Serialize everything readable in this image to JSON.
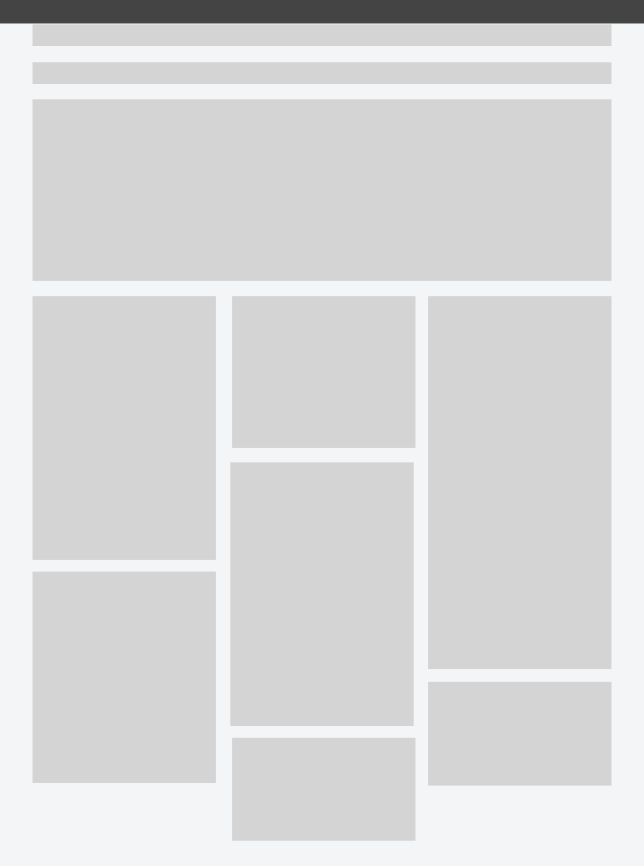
{
  "colors": {
    "topbar": "#444444",
    "background": "#f4f5f6",
    "placeholder": "#d4d4d4"
  },
  "state": "loading-skeleton"
}
